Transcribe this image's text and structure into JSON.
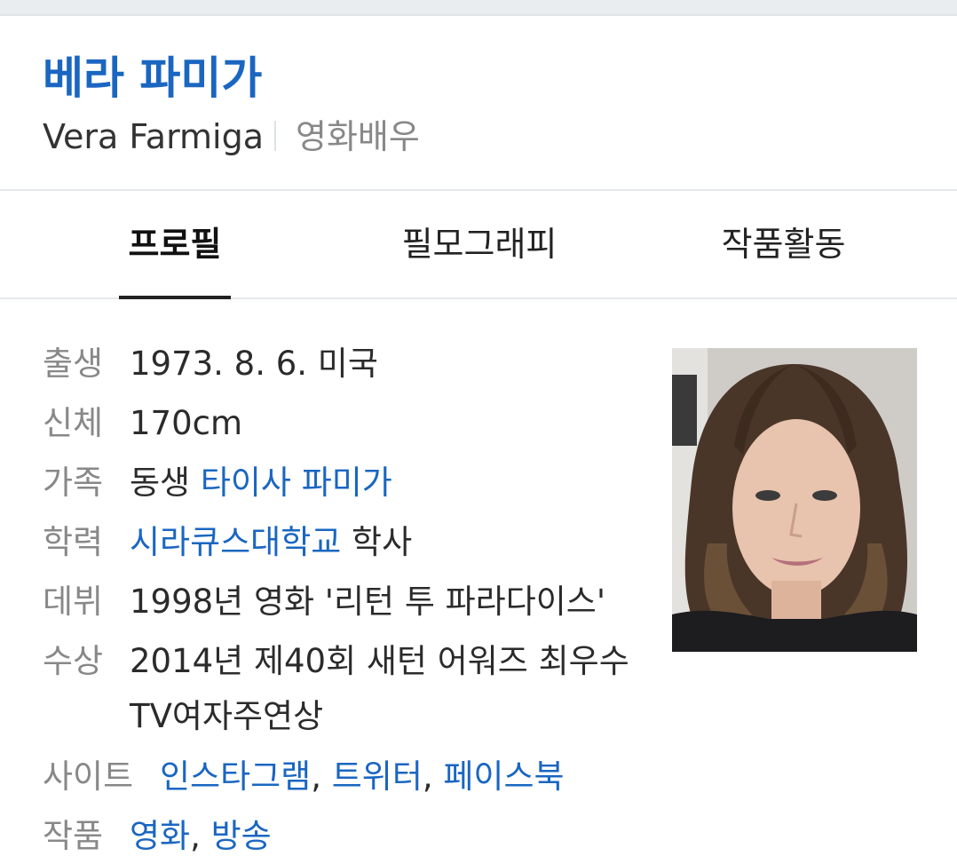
{
  "header": {
    "name_ko": "베라 파미가",
    "name_en": "Vera Farmiga",
    "occupation": "영화배우"
  },
  "tabs": [
    {
      "label": "프로필",
      "active": true
    },
    {
      "label": "필모그래피",
      "active": false
    },
    {
      "label": "작품활동",
      "active": false
    }
  ],
  "profile": {
    "birth": {
      "label": "출생",
      "value": "1973. 8. 6. 미국"
    },
    "body": {
      "label": "신체",
      "value": "170cm"
    },
    "family": {
      "label": "가족",
      "prefix": "동생 ",
      "link": "타이사 파미가"
    },
    "education": {
      "label": "학력",
      "link": "시라큐스대학교",
      "suffix": " 학사"
    },
    "debut": {
      "label": "데뷔",
      "value": "1998년 영화 '리턴 투 파라다이스'"
    },
    "awards": {
      "label": "수상",
      "line1": "2014년 제40회 새턴 어워즈 최우수",
      "line2": "TV여자주연상"
    },
    "sites": {
      "label": "사이트",
      "link1": "인스타그램",
      "sep1": ", ",
      "link2": "트위터",
      "sep2": ", ",
      "link3": "페이스북"
    },
    "works": {
      "label": "작품",
      "link1": "영화",
      "sep": ", ",
      "link2": "방송"
    }
  },
  "colors": {
    "link": "#1a66c1",
    "label": "#888888",
    "text": "#2b2b2b"
  }
}
